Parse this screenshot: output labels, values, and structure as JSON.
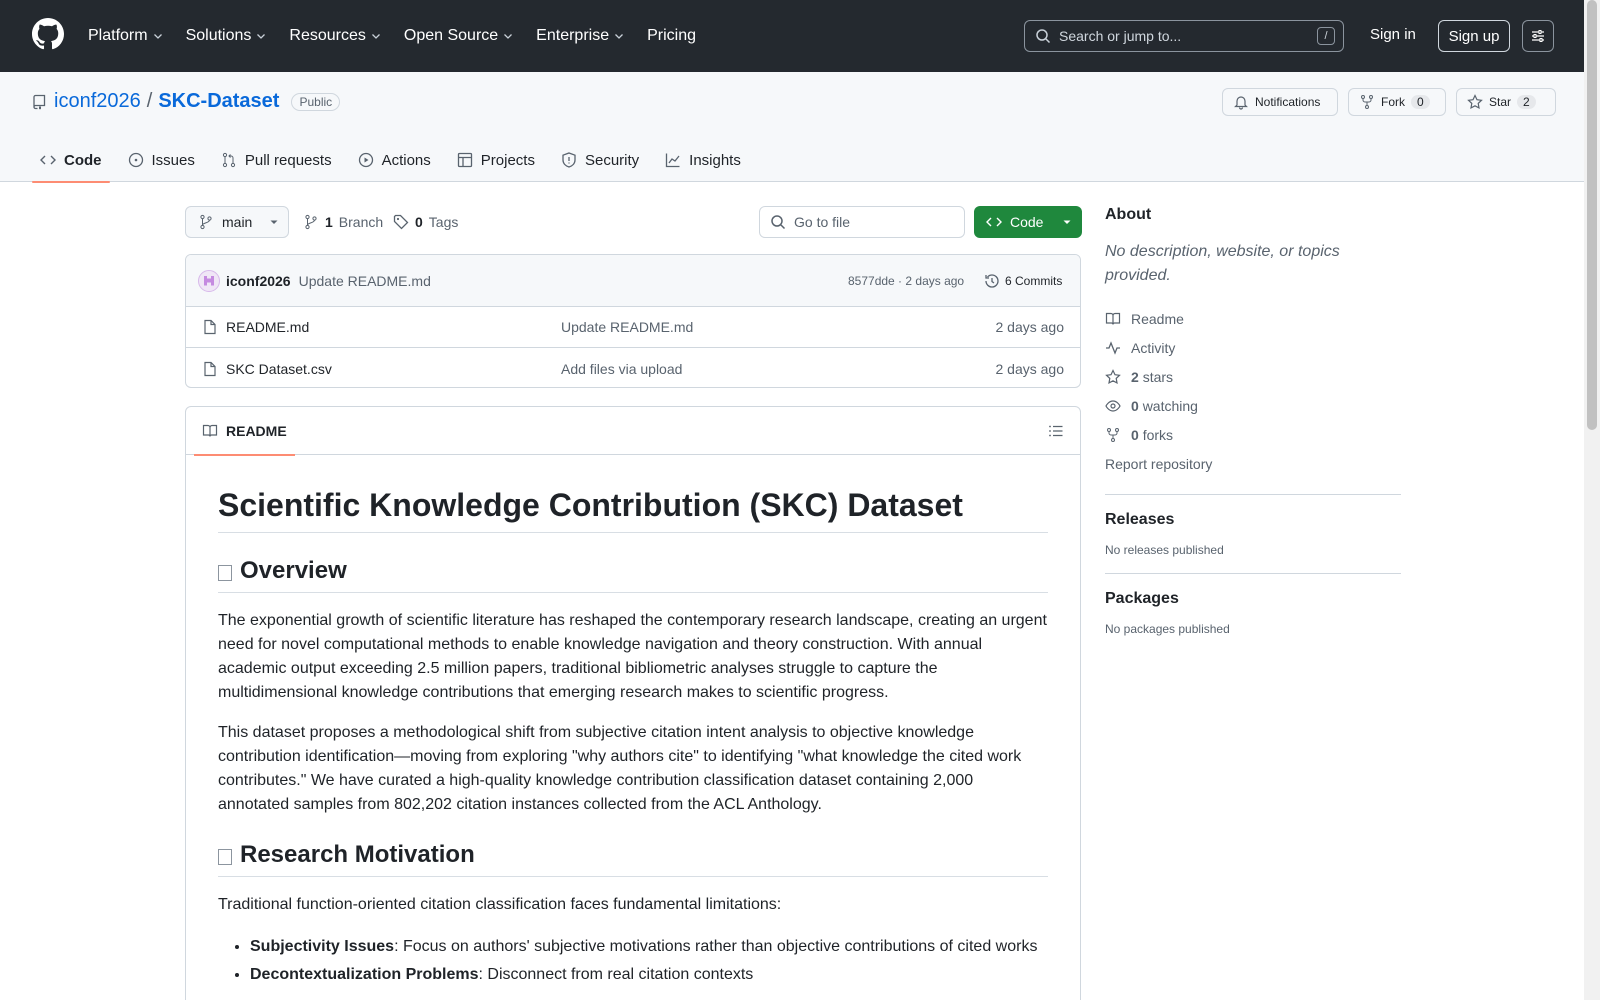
{
  "header": {
    "nav": [
      {
        "label": "Platform",
        "dropdown": true
      },
      {
        "label": "Solutions",
        "dropdown": true
      },
      {
        "label": "Resources",
        "dropdown": true
      },
      {
        "label": "Open Source",
        "dropdown": true
      },
      {
        "label": "Enterprise",
        "dropdown": true
      },
      {
        "label": "Pricing",
        "dropdown": false
      }
    ],
    "search_placeholder": "Search or jump to...",
    "search_shortcut": "/",
    "sign_in": "Sign in",
    "sign_up": "Sign up"
  },
  "repo": {
    "owner": "iconf2026",
    "separator": "/",
    "name": "SKC-Dataset",
    "visibility": "Public",
    "notifications": "Notifications",
    "fork_label": "Fork",
    "fork_count": "0",
    "star_label": "Star",
    "star_count": "2",
    "tabs": [
      "Code",
      "Issues",
      "Pull requests",
      "Actions",
      "Projects",
      "Security",
      "Insights"
    ]
  },
  "code": {
    "branch": "main",
    "branch_count": "1",
    "branch_label": "Branch",
    "tag_count": "0",
    "tag_label": "Tags",
    "go_to_file": "Go to file",
    "code_button": "Code",
    "commit": {
      "author": "iconf2026",
      "message": "Update README.md",
      "meta": "8577dde · 2 days ago",
      "commits": "6 Commits"
    },
    "files": [
      {
        "name": "README.md",
        "message": "Update README.md",
        "time": "2 days ago"
      },
      {
        "name": "SKC Dataset.csv",
        "message": "Add files via upload",
        "time": "2 days ago"
      }
    ]
  },
  "readme": {
    "tab": "README",
    "h1": "Scientific Knowledge Contribution (SKC) Dataset",
    "h2_overview": "Overview",
    "p1": "The exponential growth of scientific literature has reshaped the contemporary research landscape, creating an urgent need for novel computational methods to enable knowledge navigation and theory construction. With annual academic output exceeding 2.5 million papers, traditional bibliometric analyses struggle to capture the multidimensional knowledge contributions that emerging research makes to scientific progress.",
    "p2": "This dataset proposes a methodological shift from subjective citation intent analysis to objective knowledge contribution identification—moving from exploring \"why authors cite\" to identifying \"what knowledge the cited work contributes.\" We have curated a high-quality knowledge contribution classification dataset containing 2,000 annotated samples from 802,202 citation instances collected from the ACL Anthology.",
    "h2_motivation": "Research Motivation",
    "p3": "Traditional function-oriented citation classification faces fundamental limitations:",
    "bullets": [
      {
        "bold": "Subjectivity Issues",
        "text": ": Focus on authors' subjective motivations rather than objective contributions of cited works"
      },
      {
        "bold": "Decontextualization Problems",
        "text": ": Disconnect from real citation contexts"
      }
    ]
  },
  "sidebar": {
    "about": "About",
    "description": "No description, website, or topics provided.",
    "readme": "Readme",
    "activity": "Activity",
    "stars_count": "2",
    "stars": "stars",
    "watching_count": "0",
    "watching": "watching",
    "forks_count": "0",
    "forks": "forks",
    "report": "Report repository",
    "releases": "Releases",
    "no_releases": "No releases published",
    "packages": "Packages",
    "no_packages": "No packages published"
  }
}
